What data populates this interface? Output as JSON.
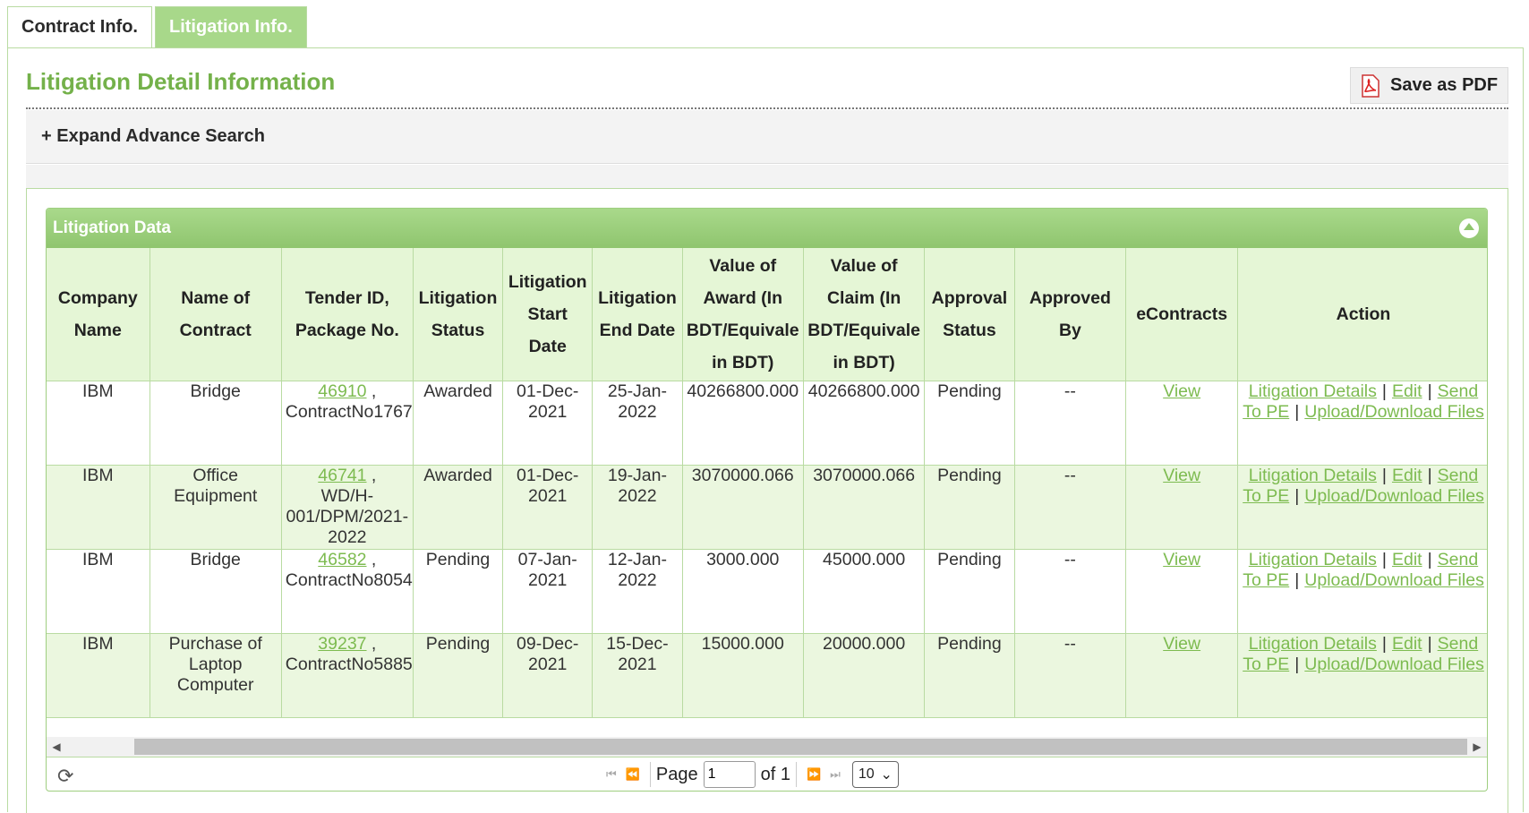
{
  "tabs": [
    {
      "label": "Contract Info."
    },
    {
      "label": "Litigation Info."
    }
  ],
  "page": {
    "title": "Litigation Detail Information",
    "pdf_label": "Save as PDF",
    "advance_search": "+ Expand Advance Search"
  },
  "grid": {
    "caption": "Litigation Data",
    "headers": [
      "Company Name",
      "Name of Contract",
      "Tender ID, Package No.",
      "Litigation Status",
      "Litigation Start Date",
      "Litigation End Date",
      "Value of Award (In BDT/Equivale in BDT)",
      "Value of Claim (In BDT/Equivale in BDT)",
      "Approval Status",
      "Approved By",
      "eContracts",
      "Action"
    ],
    "rows": [
      {
        "company": "IBM",
        "contract": "Bridge",
        "tender_id": "46910",
        "package": "ContractNo1767",
        "status": "Awarded",
        "start": "01-Dec-2021",
        "end": "25-Jan-2022",
        "award": "40266800.000",
        "claim": "40266800.000",
        "approval": "Pending",
        "approved_by": "--",
        "econtracts": "View"
      },
      {
        "company": "IBM",
        "contract": "Office Equipment",
        "tender_id": "46741",
        "package": "WD/H-001/DPM/2021-2022",
        "status": "Awarded",
        "start": "01-Dec-2021",
        "end": "19-Jan-2022",
        "award": "3070000.066",
        "claim": "3070000.066",
        "approval": "Pending",
        "approved_by": "--",
        "econtracts": "View"
      },
      {
        "company": "IBM",
        "contract": "Bridge",
        "tender_id": "46582",
        "package": "ContractNo8054",
        "status": "Pending",
        "start": "07-Jan-2021",
        "end": "12-Jan-2022",
        "award": "3000.000",
        "claim": "45000.000",
        "approval": "Pending",
        "approved_by": "--",
        "econtracts": "View"
      },
      {
        "company": "IBM",
        "contract": "Purchase of Laptop Computer",
        "tender_id": "39237",
        "package": "ContractNo5885",
        "status": "Pending",
        "start": "09-Dec-2021",
        "end": "15-Dec-2021",
        "award": "15000.000",
        "claim": "20000.000",
        "approval": "Pending",
        "approved_by": "--",
        "econtracts": "View"
      }
    ],
    "actions": {
      "details": "Litigation Details",
      "edit": "Edit",
      "send": "Send To PE",
      "upload": "Upload/Download Files"
    },
    "pager": {
      "page_label": "Page",
      "page_value": "1",
      "of_label": "of 1",
      "rows_per_page": "10"
    }
  },
  "colors": {
    "accent": "#74b14a",
    "tab_active": "#a8d88a",
    "caption_bar": "#9bd07c",
    "header_bg": "#e5f6d6",
    "row_alt": "#ebf7df",
    "link": "#7dbb50"
  },
  "icons": [
    "pdf-icon",
    "collapse-icon",
    "refresh-icon",
    "first-page-icon",
    "prev-page-icon",
    "next-page-icon",
    "last-page-icon",
    "dropdown-chevron-icon"
  ]
}
